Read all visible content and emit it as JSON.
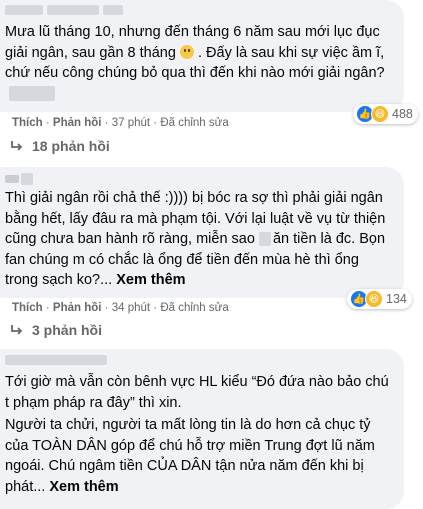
{
  "comments": [
    {
      "text_parts": [
        "Mưa lũ tháng 10, nhưng đến tháng 6 năm sau mới lục đục giải ngân, sau gần 8 tháng ",
        " . Đấy là sau khi sự việc ầm ĩ, chứ nếu công chúng bỏ qua thì đến khi nào mới giải ngân?"
      ],
      "emoji": "slightly-smiling-face",
      "actions": {
        "like": "Thích",
        "reply": "Phản hồi",
        "time": "37 phút",
        "edited": "Đã chỉnh sửa"
      },
      "reactions": {
        "icons": [
          "like-icon",
          "haha-icon"
        ],
        "count": "488"
      },
      "replies_label": "18 phản hồi"
    },
    {
      "text": "Thì giải ngân rồi chả thế :)))) bị bóc ra sợ thì phải giải ngân bằng hết, lấy đâu ra mà phạm tội. Với lại luật về vụ từ thiện cũng chưa ban hành rõ ràng, miễn sao ",
      "text_tail": "ăn tiền là đc. Bọn fan chúng m có chắc là ổng để tiền đến mùa hè thì ổng trong sạch ko?... ",
      "see_more": "Xem thêm",
      "actions": {
        "like": "Thích",
        "reply": "Phản hồi",
        "time": "34 phút",
        "edited": "Đã chỉnh sửa"
      },
      "reactions": {
        "icons": [
          "like-icon",
          "haha-icon"
        ],
        "count": "134"
      },
      "replies_label": "3 phản hồi"
    },
    {
      "text_p1": "Tới giờ mà vẫn còn bênh vực HL kiểu “Đó đứa nào bảo chú t phạm pháp ra đây” thì xin.",
      "text_p2": "Người ta chửi, người ta mất lòng tin là do hơn cả chục tỷ của TOÀN DÂN góp để chú hỗ trợ miền Trung đợt lũ năm ngoái. Chú ngâm tiền CỦA DÂN tận nửa năm đến khi bị phát... ",
      "see_more": "Xem thêm"
    }
  ],
  "separator": " · ",
  "colors": {
    "bubble": "#f0f2f5",
    "meta": "#65676b",
    "like": "#1877f2",
    "haha": "#f7b928"
  }
}
